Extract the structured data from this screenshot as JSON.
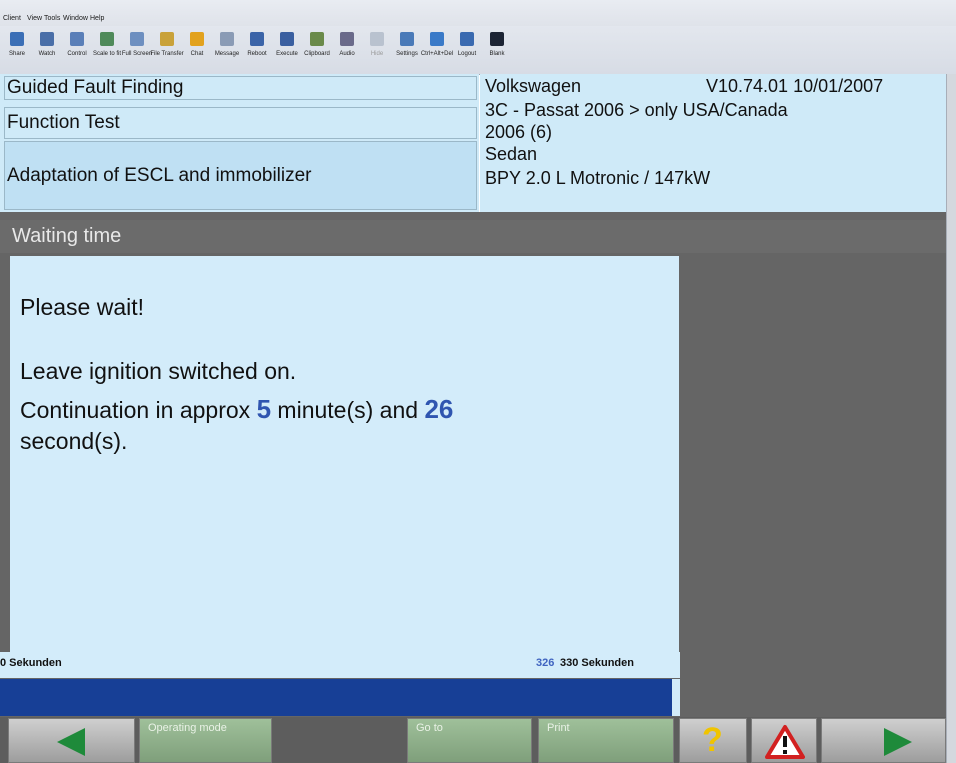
{
  "menu": [
    "Client",
    "View",
    "Tools",
    "Window",
    "Help"
  ],
  "toolbar": [
    {
      "label": "Share",
      "icon": "share-icon",
      "color": "#3b6fb6"
    },
    {
      "label": "Watch",
      "icon": "watch-icon",
      "color": "#4a6fa8"
    },
    {
      "label": "Control",
      "icon": "control-icon",
      "color": "#5a7fb8"
    },
    {
      "label": "Scale to fit",
      "icon": "scale-icon",
      "color": "#4f8a5a"
    },
    {
      "label": "Full Screen",
      "icon": "fullscreen-icon",
      "color": "#6d8fc0"
    },
    {
      "label": "File Transfer",
      "icon": "file-transfer-icon",
      "color": "#c9a23a"
    },
    {
      "label": "Chat",
      "icon": "chat-icon",
      "color": "#e2a21e"
    },
    {
      "label": "Message",
      "icon": "message-icon",
      "color": "#8a9bb5"
    },
    {
      "label": "Reboot",
      "icon": "reboot-icon",
      "color": "#3b64a8"
    },
    {
      "label": "Execute",
      "icon": "execute-icon",
      "color": "#3a5fa0"
    },
    {
      "label": "Clipboard",
      "icon": "clipboard-icon",
      "color": "#6a8a4a"
    },
    {
      "label": "Audio",
      "icon": "audio-icon",
      "color": "#6a6a8a"
    },
    {
      "label": "Hide",
      "icon": "hide-icon",
      "color": "#b9c2cf",
      "disabled": true
    },
    {
      "label": "Settings",
      "icon": "settings-icon",
      "color": "#4a7ab8"
    },
    {
      "label": "Ctrl+Alt+Del",
      "icon": "ctrl-alt-del-icon",
      "color": "#3a7ac8"
    },
    {
      "label": "Logout",
      "icon": "logout-icon",
      "color": "#3a6ab0"
    },
    {
      "label": "Blank",
      "icon": "blank-icon",
      "color": "#1c2434"
    }
  ],
  "header": {
    "mode": "Guided Fault Finding",
    "test": "Function Test",
    "procedure": "Adaptation of ESCL and immobilizer",
    "make": "Volkswagen",
    "version": "V10.74.01 10/01/2007",
    "model": "3C - Passat 2006 > only USA/Canada",
    "year": "2006 (6)",
    "body": "Sedan",
    "engine": "BPY 2.0 L Motronic / 147kW"
  },
  "section_title": "Waiting time",
  "message": {
    "line1": "Please wait!",
    "line2": "Leave ignition switched on.",
    "line3_pre": "Continuation in approx ",
    "minutes": "5",
    "line3_mid": " minute(s) and ",
    "seconds": "26",
    "line4": "second(s)."
  },
  "progress": {
    "start_label": "0 Sekunden",
    "current": "326",
    "end_label": "330 Sekunden",
    "fraction": 0.988
  },
  "buttons": {
    "back_icon": "arrow-left-icon",
    "operating_mode": "Operating mode",
    "go_to": "Go to",
    "print": "Print",
    "help": "?",
    "help_icon": "question-icon",
    "warning_icon": "warning-triangle-icon",
    "forward_icon": "arrow-right-icon"
  }
}
